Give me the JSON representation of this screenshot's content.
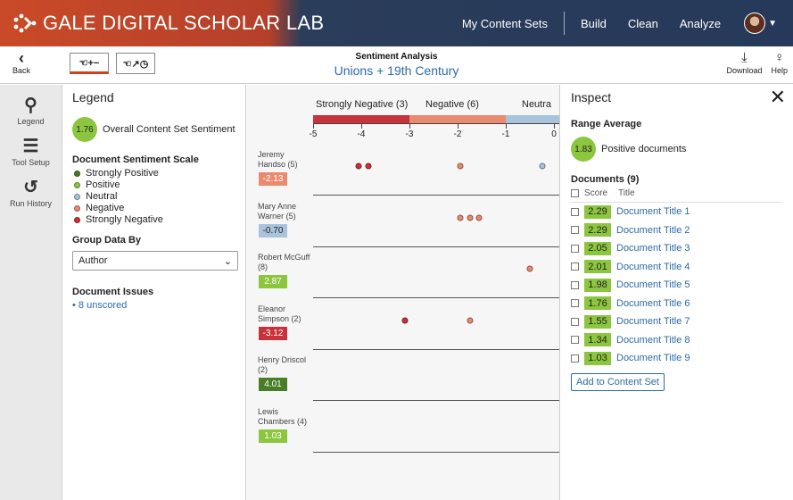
{
  "app": {
    "brand": "GALE DIGITAL SCHOLAR LAB",
    "nav": [
      "My Content Sets",
      "Build",
      "Clean",
      "Analyze"
    ]
  },
  "toolbar": {
    "back_label": "Back",
    "view_title": "Sentiment Analysis",
    "content_set": "Unions + 19th Century",
    "download_label": "Download",
    "help_label": "Help"
  },
  "rail": [
    {
      "label": "Legend",
      "icon": "search-icon"
    },
    {
      "label": "Tool Setup",
      "icon": "sliders-icon"
    },
    {
      "label": "Run History",
      "icon": "history-icon"
    }
  ],
  "legend": {
    "title": "Legend",
    "overall_value": "1.76",
    "overall_label": "Overall Content Set Sentiment",
    "scale_title": "Document Sentiment Scale",
    "scale": [
      {
        "label": "Strongly Positive",
        "color": "#4a7d28"
      },
      {
        "label": "Positive",
        "color": "#8cc63f"
      },
      {
        "label": "Neutral",
        "color": "#a9c3dc"
      },
      {
        "label": "Negative",
        "color": "#ea8a6e"
      },
      {
        "label": "Strongly Negative",
        "color": "#c8323a"
      }
    ],
    "group_title": "Group Data By",
    "group_value": "Author",
    "issues_title": "Document Issues",
    "issues_link": "• 8 unscored"
  },
  "chart_data": {
    "type": "scatter",
    "bands": [
      {
        "label": "Strongly Negative (3)",
        "color": "#c8323a",
        "from": -5,
        "to": -3
      },
      {
        "label": "Negative (6)",
        "color": "#ea8a6e",
        "from": -3,
        "to": -1
      },
      {
        "label": "Neutra",
        "color": "#a9c3dc",
        "from": -1,
        "to": 1
      }
    ],
    "ticks": [
      "-5",
      "-4",
      "-3",
      "-2",
      "-1",
      "0"
    ],
    "rows": [
      {
        "name": "Jeremy Handso (5)",
        "score": "-2.13",
        "color": "#ea8a6e",
        "points": [
          {
            "x": -4.05,
            "c": "#c8323a"
          },
          {
            "x": -3.85,
            "c": "#c8323a"
          },
          {
            "x": -1.95,
            "c": "#ea8a6e"
          },
          {
            "x": -0.25,
            "c": "#a9c3dc"
          }
        ]
      },
      {
        "name": "Mary Anne Warner (5)",
        "score": "-0.70",
        "color": "#a9c3dc",
        "points": [
          {
            "x": -1.95,
            "c": "#ea8a6e"
          },
          {
            "x": -1.75,
            "c": "#ea8a6e"
          },
          {
            "x": -1.55,
            "c": "#ea8a6e"
          }
        ]
      },
      {
        "name": "Robert McGuff (8)",
        "score": "2.87",
        "color": "#8cc63f",
        "points": [
          {
            "x": -0.5,
            "c": "#ea8a6e"
          }
        ]
      },
      {
        "name": "Eleanor Simpson (2)",
        "score": "-3.12",
        "color": "#c8323a",
        "points": [
          {
            "x": -3.1,
            "c": "#c8323a"
          },
          {
            "x": -1.75,
            "c": "#ea8a6e"
          }
        ]
      },
      {
        "name": "Henry Driscol (2)",
        "score": "4.01",
        "color": "#4a7d28",
        "points": []
      },
      {
        "name": "Lewis Chambers (4)",
        "score": "1.03",
        "color": "#8cc63f",
        "points": []
      }
    ]
  },
  "inspect": {
    "title": "Inspect",
    "range_title": "Range Average",
    "range_value": "1.83",
    "range_label": "Positive documents",
    "docs_title": "Documents (9)",
    "head_score": "Score",
    "head_title": "Title",
    "documents": [
      {
        "score": "2.29",
        "title": "Document Title 1"
      },
      {
        "score": "2.29",
        "title": "Document Title 2"
      },
      {
        "score": "2.05",
        "title": "Document Title 3"
      },
      {
        "score": "2.01",
        "title": "Document Title 4"
      },
      {
        "score": "1.98",
        "title": "Document Title 5"
      },
      {
        "score": "1.76",
        "title": "Document Title 6"
      },
      {
        "score": "1.55",
        "title": "Document Title 7"
      },
      {
        "score": "1.34",
        "title": "Document Title 8"
      },
      {
        "score": "1.03",
        "title": "Document Title 9"
      }
    ],
    "add_button": "Add to Content Set"
  }
}
